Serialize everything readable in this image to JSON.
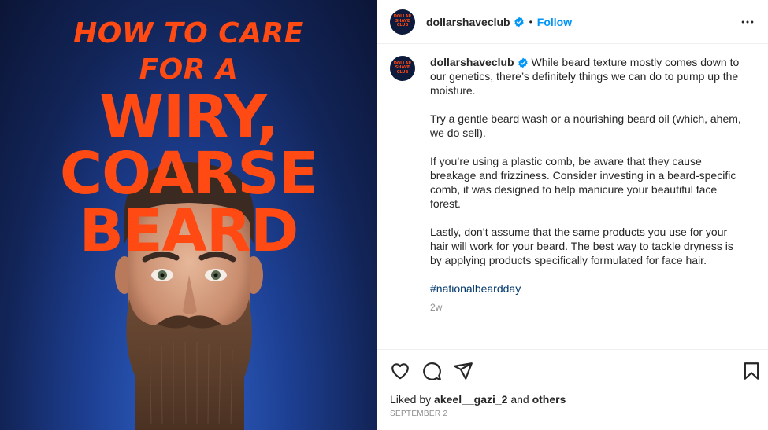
{
  "media": {
    "headline_line1": "HOW TO CARE",
    "headline_line2": "FOR A",
    "headline_line3": "WIRY,",
    "headline_line4": "COARSE",
    "headline_line5": "BEARD",
    "headline_color": "#ff4a14",
    "background_color": "#1d3f92"
  },
  "header": {
    "avatar_text": [
      "DOLLAR",
      "SHAVE",
      "CLUB"
    ],
    "username": "dollarshaveclub",
    "separator": "•",
    "follow_label": "Follow",
    "more_icon": "more-options-icon"
  },
  "caption": {
    "username": "dollarshaveclub",
    "paragraphs": [
      "While beard texture mostly comes down to our genetics, there’s definitely things we can do to pump up the moisture.",
      "Try a gentle beard wash or a nourishing beard oil (which, ahem, we do sell).",
      "If you’re using a plastic comb, be aware that they cause breakage and frizziness. Consider investing in a beard-specific comb, it was designed to help manicure your beautiful face forest.",
      "Lastly, don’t assume that the same products you use for your hair will work for your beard. The best way to tackle dryness is by applying products specifically formulated for face hair."
    ],
    "hashtag": "#nationalbeardday",
    "time_ago": "2w"
  },
  "actions": {
    "like_icon": "heart-icon",
    "comment_icon": "comment-icon",
    "share_icon": "share-icon",
    "save_icon": "bookmark-icon",
    "liked_by_prefix": "Liked by",
    "liked_by_user": "akeel__gazi_2",
    "liked_by_and": "and",
    "liked_by_others": "others",
    "date": "SEPTEMBER 2"
  },
  "colors": {
    "accent": "#0095f6",
    "hashtag": "#00376b",
    "muted": "#8e8e8e"
  }
}
